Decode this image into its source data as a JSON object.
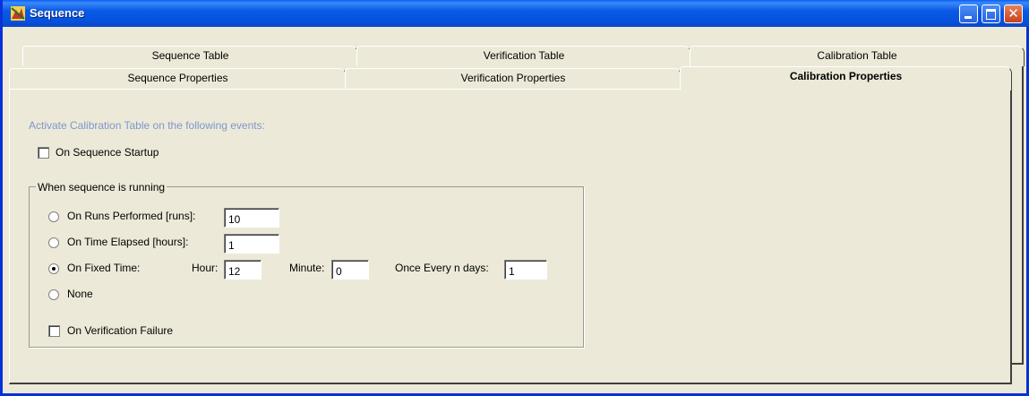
{
  "window": {
    "title": "Sequence",
    "app_icon": "sequence-app-icon",
    "controls": [
      "minimize",
      "maximize",
      "close"
    ],
    "close_glyph": "✕"
  },
  "tabs": {
    "back_row": [
      "Sequence Table",
      "Verification Table",
      "Calibration Table"
    ],
    "front_row": [
      "Sequence Properties",
      "Verification Properties",
      "Calibration Properties"
    ],
    "active": "Calibration Properties"
  },
  "calibration": {
    "activate_label": "Activate Calibration Table on the following events:",
    "on_startup": {
      "label": "On Sequence Startup",
      "checked": false
    },
    "running_group": {
      "legend": "When sequence is running",
      "runs": {
        "label": "On Runs Performed [runs]:",
        "value": "10",
        "selected": false
      },
      "time": {
        "label": "On Time Elapsed [hours]:",
        "value": "1",
        "selected": false
      },
      "fixed": {
        "label": "On Fixed Time:",
        "selected": true,
        "hour_label": "Hour:",
        "hour_value": "12",
        "minute_label": "Minute:",
        "minute_value": "0",
        "days_label": "Once Every n days:",
        "days_value": "1"
      },
      "none": {
        "label": "None",
        "selected": false
      },
      "verification_failure": {
        "label": "On Verification Failure",
        "checked": false
      }
    }
  }
}
